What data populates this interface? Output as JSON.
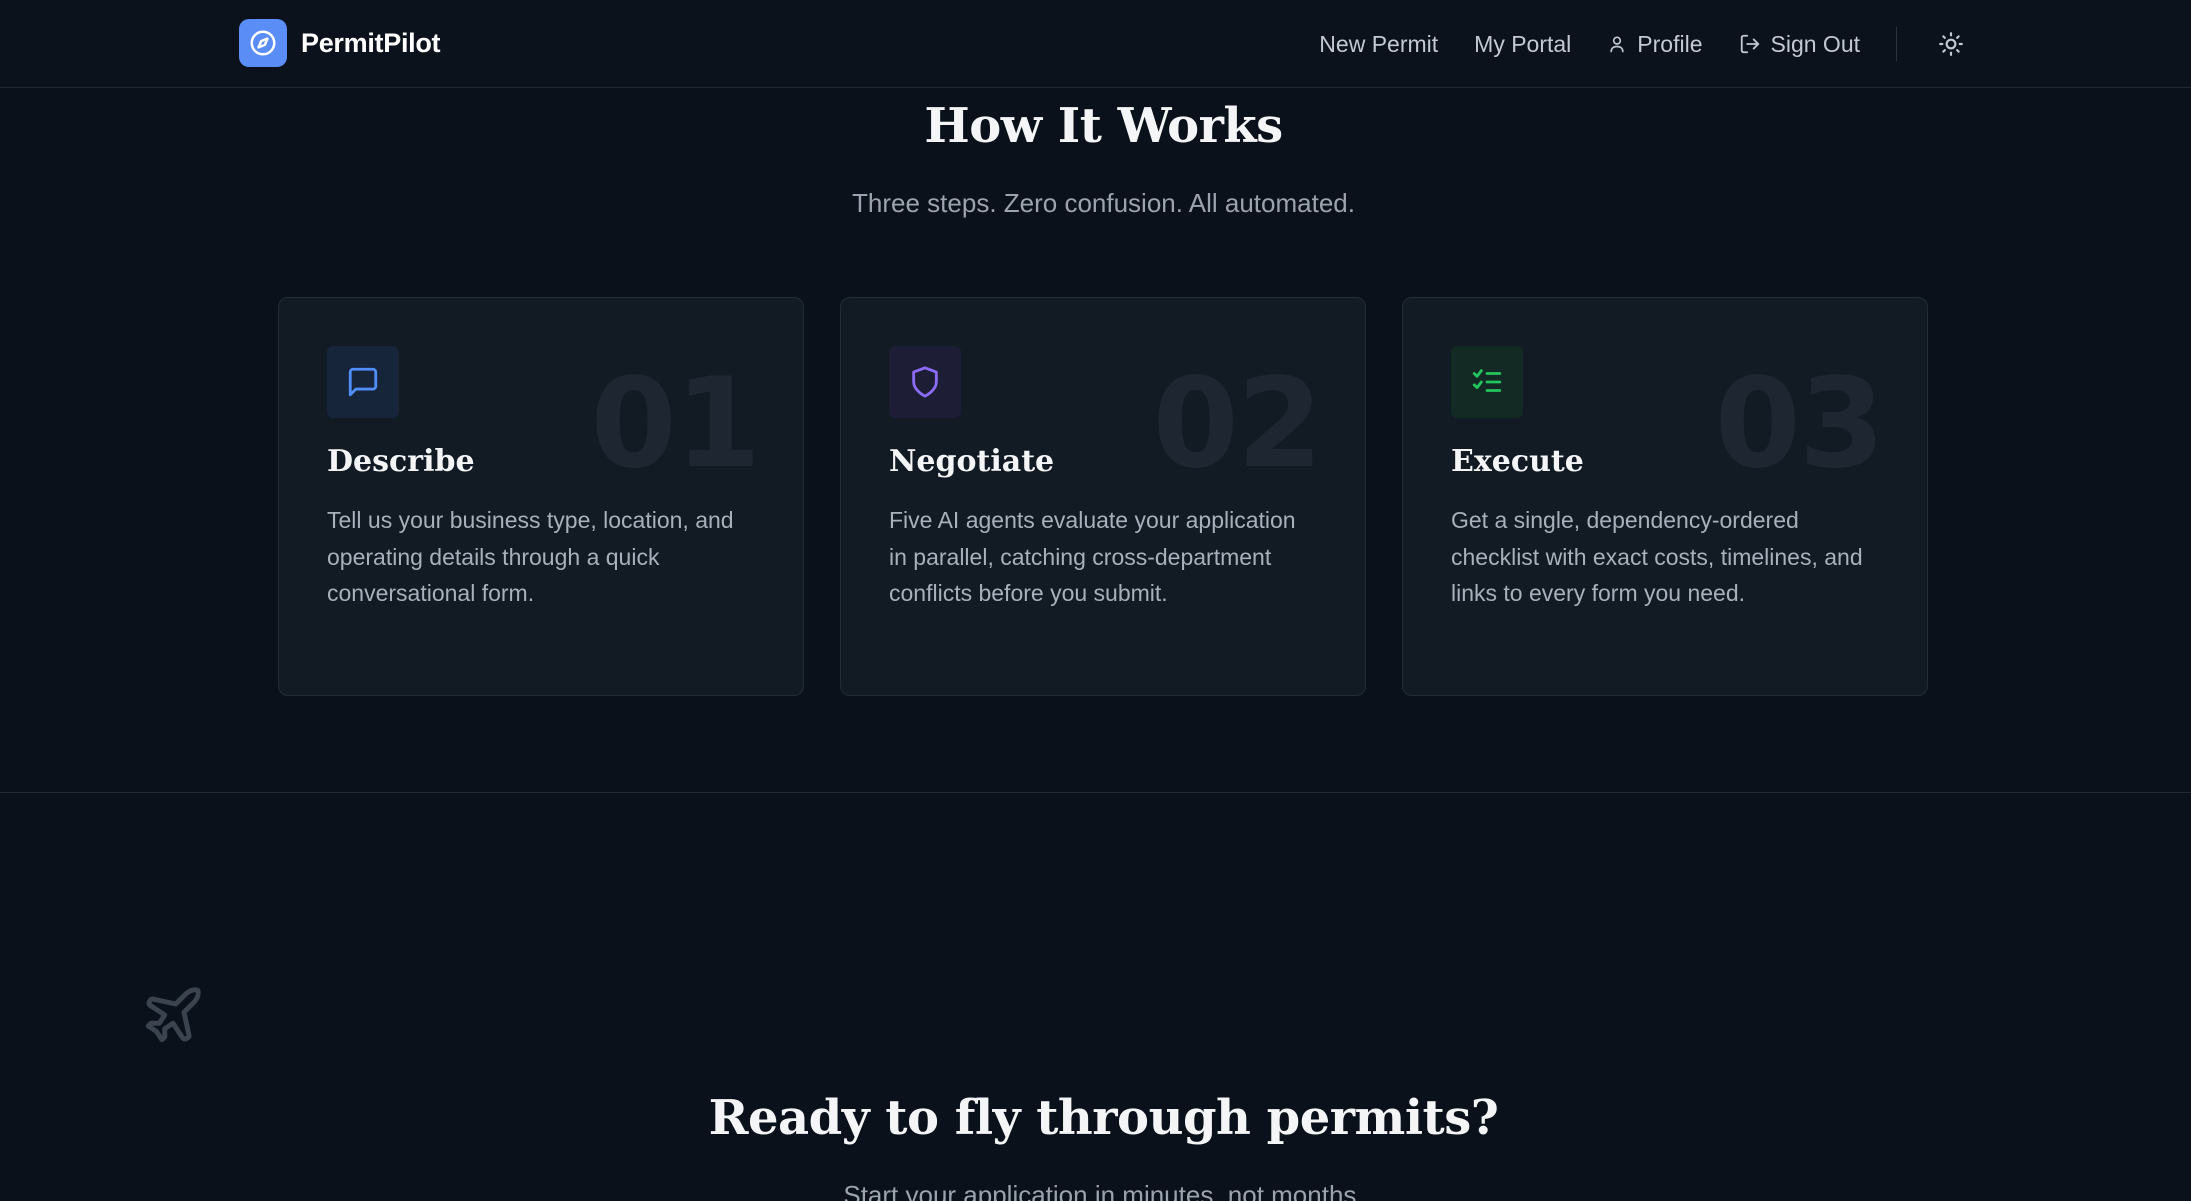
{
  "navbar": {
    "brand_name": "PermitPilot",
    "brand_icon": "compass-icon",
    "links": {
      "new_permit": "New Permit",
      "my_portal": "My Portal",
      "profile": "Profile",
      "sign_out": "Sign Out"
    },
    "theme_icon": "sun-icon"
  },
  "how_it_works": {
    "title": "How It Works",
    "subtitle": "Three steps. Zero confusion. All automated.",
    "steps": [
      {
        "number": "01",
        "title": "Describe",
        "text": "Tell us your business type, location, and operating details through a quick conversational form.",
        "icon": "message-square-icon",
        "accent": "#4f8ef7"
      },
      {
        "number": "02",
        "title": "Negotiate",
        "text": "Five AI agents evaluate your application in parallel, catching cross-department conflicts before you submit.",
        "icon": "shield-icon",
        "accent": "#8b6cf6"
      },
      {
        "number": "03",
        "title": "Execute",
        "text": "Get a single, dependency-ordered checklist with exact costs, timelines, and links to every form you need.",
        "icon": "list-checks-icon",
        "accent": "#22c55e"
      }
    ]
  },
  "cta": {
    "icon": "plane-icon",
    "title": "Ready to fly through permits?",
    "subtitle": "Start your application in minutes, not months."
  }
}
